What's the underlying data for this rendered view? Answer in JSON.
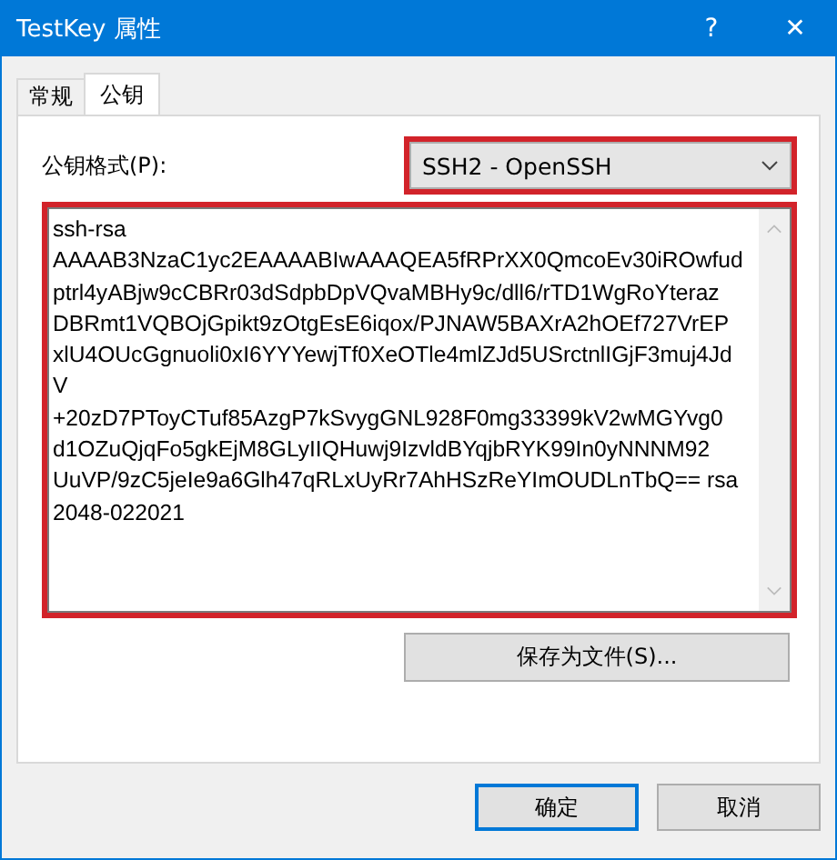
{
  "window": {
    "title": "TestKey 属性",
    "help": "?",
    "close": "✕"
  },
  "tabs": [
    {
      "label": "常规",
      "selected": false
    },
    {
      "label": "公钥",
      "selected": true
    }
  ],
  "format": {
    "label": "公钥格式(P):",
    "value": "SSH2 - OpenSSH",
    "highlighted": true
  },
  "public_key": {
    "highlighted": true,
    "lines": [
      "ssh-rsa",
      "AAAAB3NzaC1yc2EAAAABIwAAAQEA5fRPrXX0QmcoEv30iROwfud",
      "ptrl4yABjw9cCBRr03dSdpbDpVQvaMBHy9c/dll6/rTD1WgRoYteraz",
      "DBRmt1VQBOjGpikt9zOtgEsE6iqox/PJNAW5BAXrA2hOEf727VrEP",
      "xlU4OUcGgnuoli0xI6YYYewjTf0XeOTle4mlZJd5USrctnlIGjF3muj4Jd",
      "V",
      "+20zD7PToyCTuf85AzgP7kSvygGNL928F0mg33399kV2wMGYvg0",
      "d1OZuQjqFo5gkEjM8GLyIIQHuwj9IzvldBYqjbRYK99In0yNNNM92",
      "UuVP/9zC5jeIe9a6Glh47qRLxUyRr7AhHSzReYImOUDLnTbQ== rsa",
      "2048-022021"
    ]
  },
  "save_button": "保存为文件(S)...",
  "buttons": [
    {
      "label": "确定",
      "default": true
    },
    {
      "label": "取消",
      "default": false
    }
  ]
}
